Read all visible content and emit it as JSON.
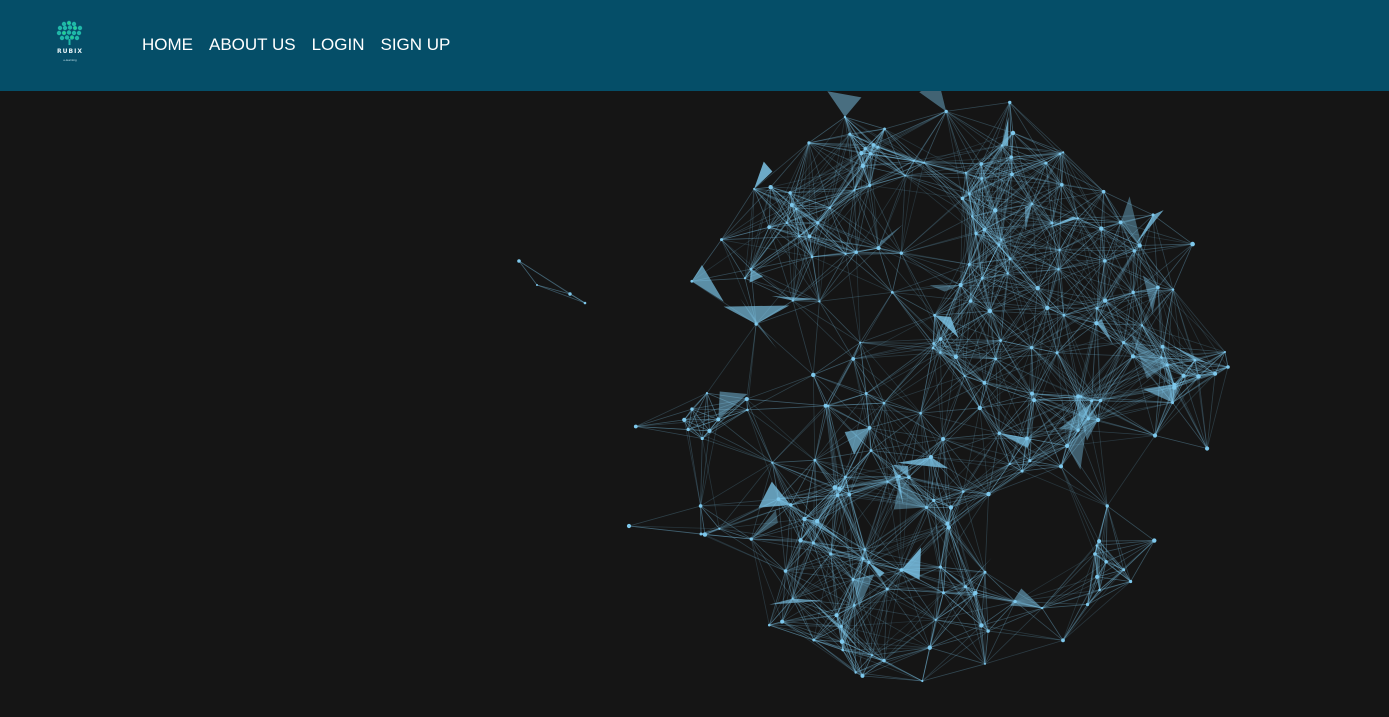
{
  "brand": {
    "name": "RUBIX",
    "tagline": "e-learning",
    "logo_colors": [
      "#1fb7a8",
      "#27c6c0",
      "#3aa0d8",
      "#2bd08a"
    ]
  },
  "nav": {
    "items": [
      {
        "label": "HOME"
      },
      {
        "label": "ABOUT US"
      },
      {
        "label": "LOGIN"
      },
      {
        "label": "SIGN UP"
      }
    ]
  },
  "theme": {
    "header_bg": "#054e68",
    "page_bg": "#151515",
    "network_color": "#7ec8ec"
  },
  "hero": {
    "background_icon": "particle-network-animation"
  }
}
